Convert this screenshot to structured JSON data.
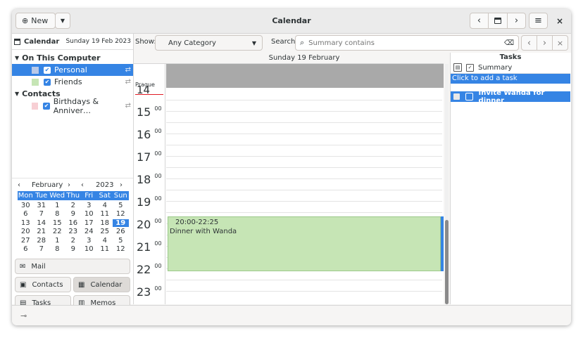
{
  "titlebar": {
    "new_label": "New",
    "title": "Calendar"
  },
  "sidebar": {
    "header_label": "Calendar",
    "header_date": "Sunday 19 Feb 2023",
    "groups": [
      {
        "label": "On This Computer"
      },
      {
        "label": "Contacts"
      }
    ],
    "sources": [
      {
        "label": "Personal",
        "color": "#b8c9e8",
        "checked": true,
        "selected": true
      },
      {
        "label": "Friends",
        "color": "#c6e5b5",
        "checked": true,
        "selected": false
      },
      {
        "label": "Birthdays & Anniver…",
        "color": "#f7cfd4",
        "checked": true,
        "selected": false
      }
    ]
  },
  "mini_calendar": {
    "month": "February",
    "year": "2023",
    "weekdays": [
      "Mon",
      "Tue",
      "Wed",
      "Thu",
      "Fri",
      "Sat",
      "Sun"
    ],
    "weeks": [
      [
        "30",
        "31",
        "1",
        "2",
        "3",
        "4",
        "5"
      ],
      [
        "6",
        "7",
        "8",
        "9",
        "10",
        "11",
        "12"
      ],
      [
        "13",
        "14",
        "15",
        "16",
        "17",
        "18",
        "19"
      ],
      [
        "20",
        "21",
        "22",
        "23",
        "24",
        "25",
        "26"
      ],
      [
        "27",
        "28",
        "1",
        "2",
        "3",
        "4",
        "5"
      ],
      [
        "6",
        "7",
        "8",
        "9",
        "10",
        "11",
        "12"
      ]
    ],
    "today": "19"
  },
  "switcher": {
    "mail": "Mail",
    "contacts": "Contacts",
    "calendar": "Calendar",
    "tasks": "Tasks",
    "memos": "Memos"
  },
  "filter": {
    "show_label": "Show:",
    "category_value": "Any Category",
    "search_label": "Search:",
    "search_placeholder": "Summary contains"
  },
  "dayview": {
    "date_header": "Sunday 19 February",
    "timezone": "Prague",
    "hours": [
      "14",
      "15",
      "16",
      "17",
      "18",
      "19",
      "20",
      "21",
      "22",
      "23"
    ],
    "minutes": "00",
    "event": {
      "time": "20:00-22:25",
      "title": "Dinner with Wanda",
      "color": "#c6e5b5",
      "border": "#3584e4"
    }
  },
  "tasks": {
    "title": "Tasks",
    "summary_header": "Summary",
    "add_placeholder": "Click to add a task",
    "items": [
      {
        "label": "Invite Wanda for dinner",
        "selected": true
      }
    ]
  },
  "colors": {
    "accent": "#3584e4"
  }
}
